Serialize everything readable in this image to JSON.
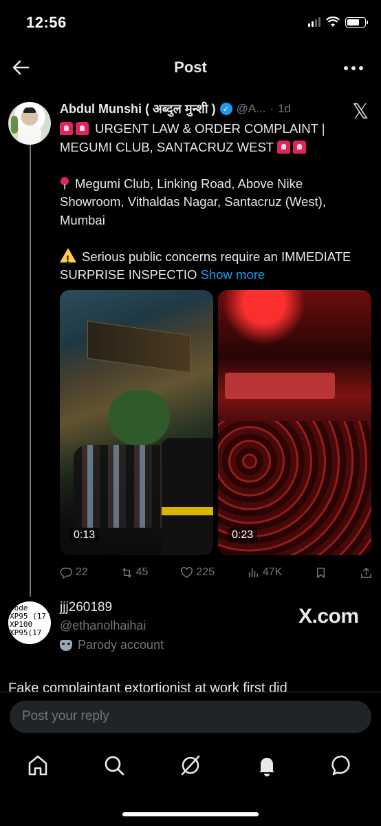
{
  "status_bar": {
    "time": "12:56"
  },
  "header": {
    "title": "Post"
  },
  "post": {
    "author_name": "Abdul Munshi ( अब्दुल मुन्शी )",
    "handle": "@A...",
    "separator": "·",
    "age": "1d",
    "title_line": "URGENT LAW & ORDER COMPLAINT | MEGUMI CLUB, SANTACRUZ WEST",
    "location": "Megumi Club, Linking Road, Above Nike Showroom, Vithaldas Nagar, Santacruz (West), Mumbai",
    "warning": "Serious public concerns require an IMMEDIATE SURPRISE INSPECTIO",
    "show_more": "Show more",
    "videos": [
      {
        "duration": "0:13"
      },
      {
        "duration": "0:23"
      }
    ],
    "stats": {
      "replies": "22",
      "reposts": "45",
      "likes": "225",
      "views": "47K"
    }
  },
  "reply": {
    "name": "jjj260189",
    "handle": "@ethanolhaihai",
    "label": "Parody account",
    "avatar_text": "code\nXP95 (17\nXP100\nXP95(17",
    "text": "Fake complaintant extortionist at work first did"
  },
  "watermark": "X.com",
  "compose": {
    "placeholder": "Post your reply"
  },
  "nav": [
    "home-icon",
    "search-icon",
    "grok-icon",
    "notifications-icon",
    "messages-icon"
  ],
  "colors": {
    "accent": "#1d9bf0",
    "muted": "#71767b",
    "background": "#000000"
  }
}
